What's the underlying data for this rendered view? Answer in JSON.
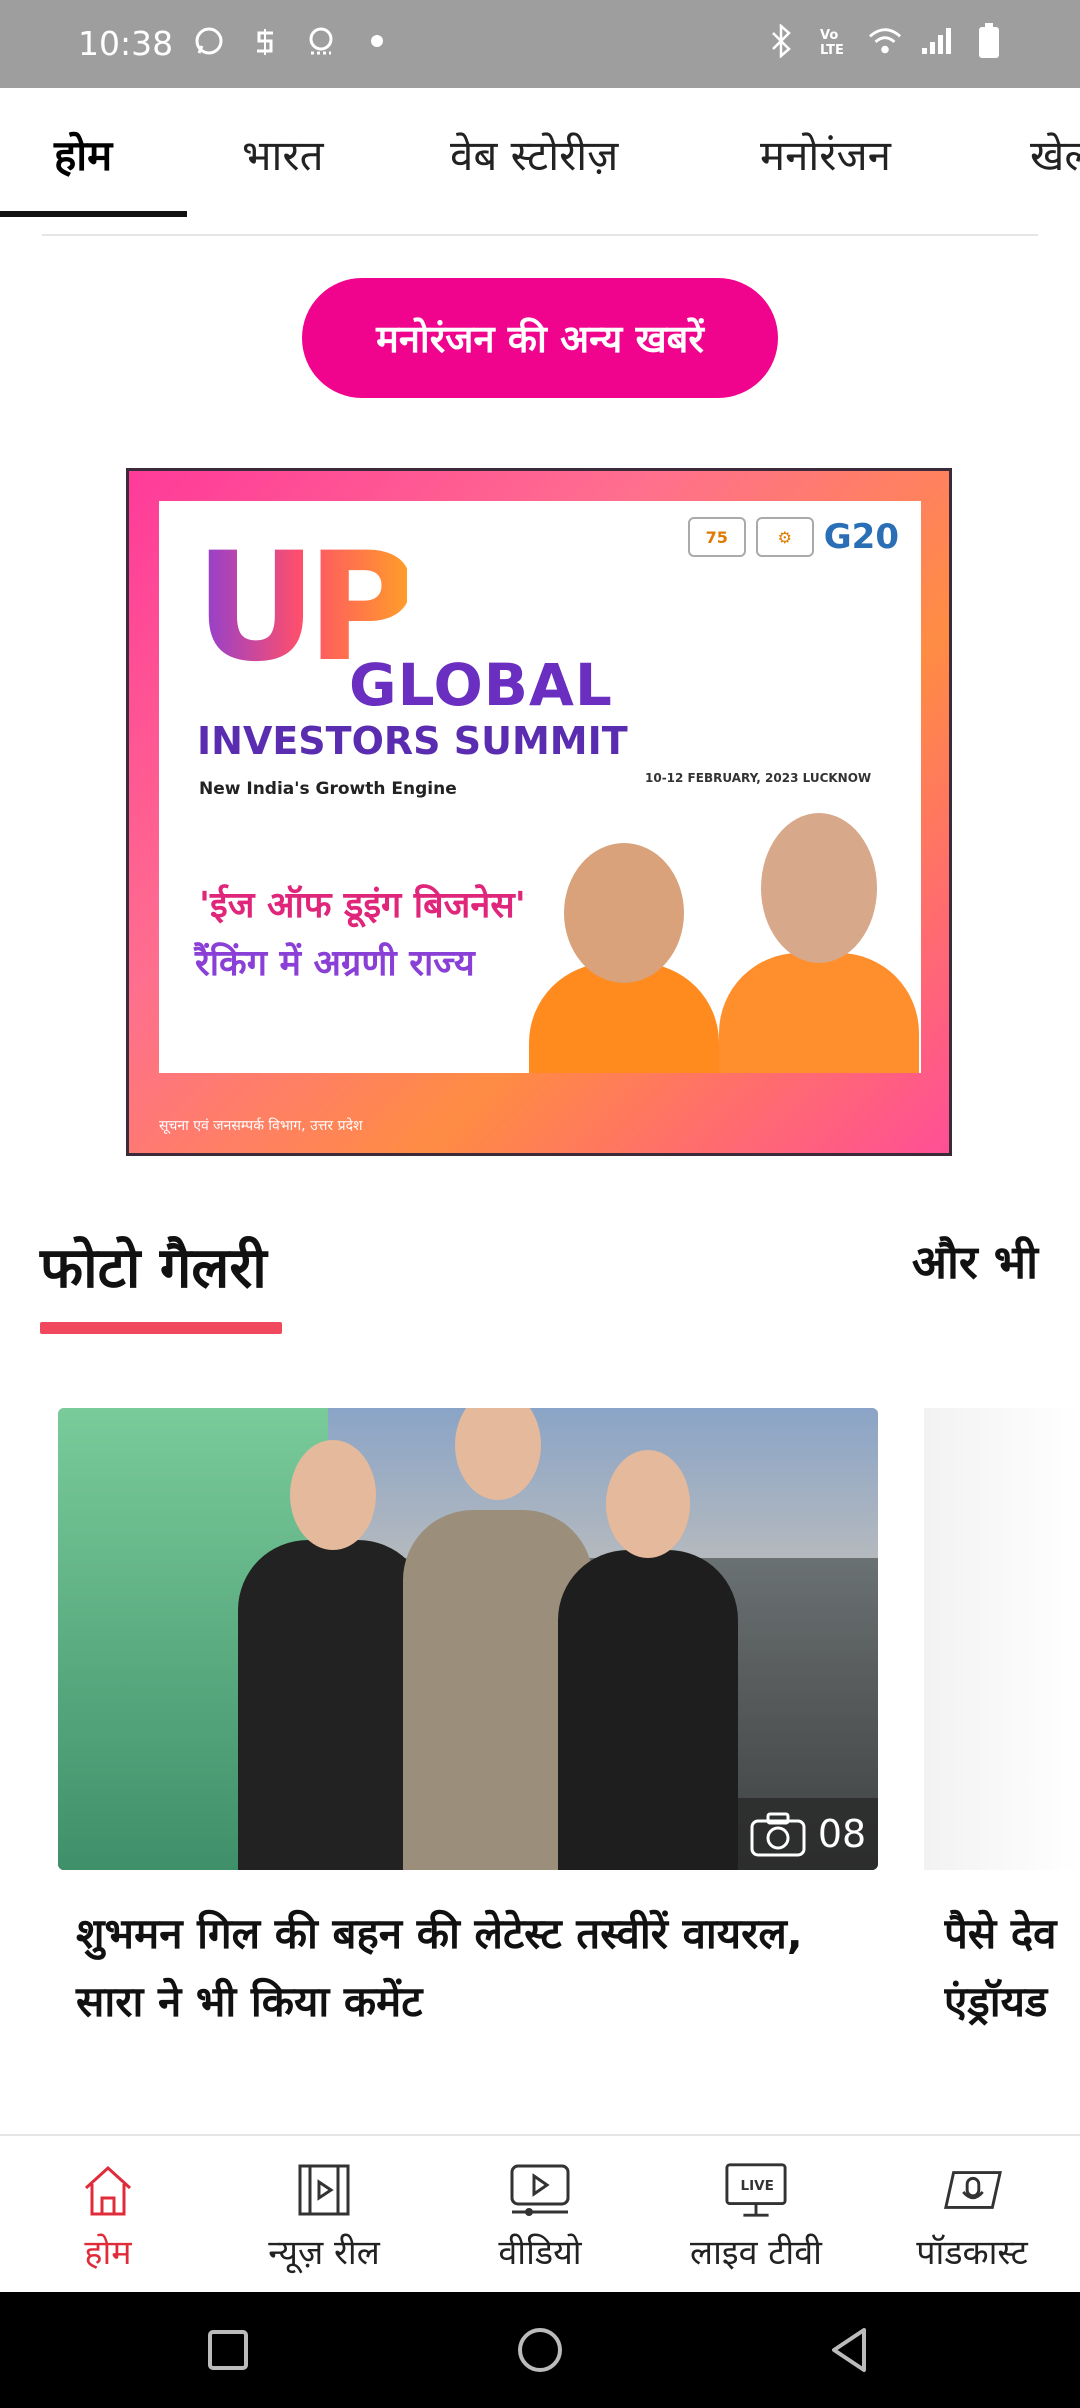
{
  "status_bar": {
    "time": "10:38"
  },
  "tabs": [
    {
      "label": "होम",
      "active": true
    },
    {
      "label": "भारत",
      "active": false
    },
    {
      "label": "वेब स्टोरीज़",
      "active": false
    },
    {
      "label": "मनोरंजन",
      "active": false
    },
    {
      "label": "खेल",
      "active": false
    }
  ],
  "entertainment_button": {
    "label": "मनोरंजन की अन्य खबरें"
  },
  "ad": {
    "title_big": "UP",
    "title_global": "GLOBAL",
    "title_summit": "INVESTORS SUMMIT",
    "dates": "10-12 FEBRUARY, 2023 LUCKNOW",
    "tagline": "New India's Growth Engine",
    "hindi_line1": "'ईज ऑफ डूइंग बिजनेस'",
    "hindi_line2": "रैंकिंग में अग्रणी राज्य",
    "g20": "G20",
    "footer": "सूचना एवं जनसम्पर्क विभाग, उत्तर प्रदेश"
  },
  "photo_gallery": {
    "title": "फोटो गैलरी",
    "more_label": "और भी",
    "cards": [
      {
        "title": "शुभमन गिल की बहन की लेटेस्ट तस्वीरें वायरल, सारा ने भी किया कमेंट",
        "photo_count": "08"
      },
      {
        "title_line1": "पैसे देव",
        "title_line2": "एंड्रॉयड"
      }
    ]
  },
  "bottom_nav": [
    {
      "label": "होम",
      "icon": "home-icon",
      "active": true
    },
    {
      "label": "न्यूज़ रील",
      "icon": "film-reel-icon",
      "active": false
    },
    {
      "label": "वीडियो",
      "icon": "video-play-icon",
      "active": false
    },
    {
      "label": "लाइव टीवी",
      "icon": "live-tv-icon",
      "active": false,
      "badge": "LIVE"
    },
    {
      "label": "पॉडकास्ट",
      "icon": "podcast-icon",
      "active": false
    }
  ],
  "colors": {
    "accent_pink": "#f0048e",
    "section_underline": "#f2485e",
    "active_nav": "#e02c3a"
  }
}
